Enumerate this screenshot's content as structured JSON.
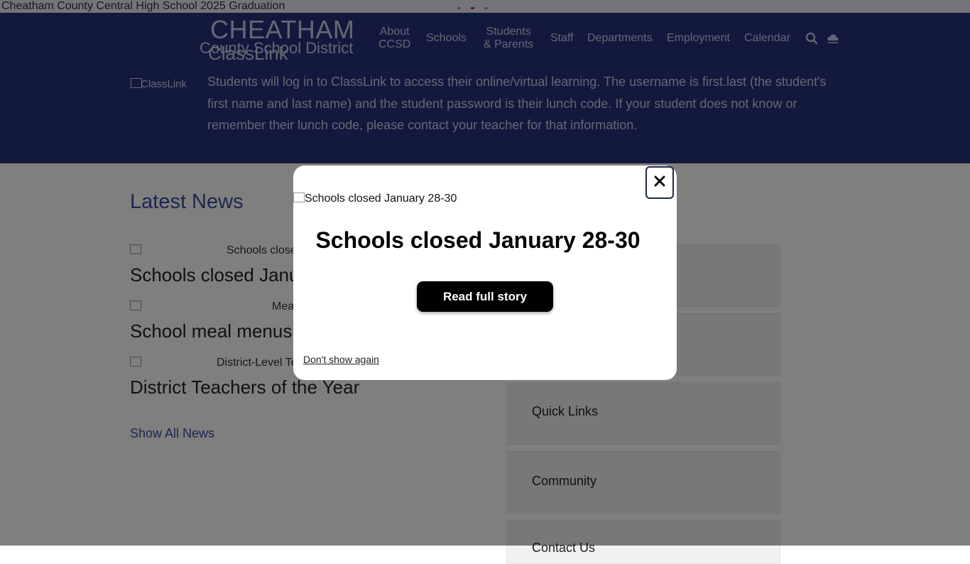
{
  "hero": {
    "image_alt": "Cheatham County Central High School 2025 Graduation",
    "dot_colors": [
      "#8a94b8",
      "#c8102e",
      "#8a94b8"
    ]
  },
  "header": {
    "logo_line1": "CHEATHAM",
    "logo_line2": "County School District",
    "logo_overlap": "ClassLink",
    "nav": [
      {
        "label_line1": "About",
        "label_line2": "CCSD"
      },
      {
        "label_line1": "Schools",
        "label_line2": ""
      },
      {
        "label_line1": "Students",
        "label_line2": "& Parents"
      },
      {
        "label_line1": "Staff",
        "label_line2": ""
      },
      {
        "label_line1": "Departments",
        "label_line2": ""
      },
      {
        "label_line1": "Employment",
        "label_line2": ""
      },
      {
        "label_line1": "Calendar",
        "label_line2": ""
      }
    ],
    "icons": {
      "search": "search-icon",
      "weather": "weather-cloud-icon"
    }
  },
  "classlink": {
    "image_alt": "ClassLink",
    "text": "Students will log in to ClassLink to access their online/virtual learning. The username is first.last (the student's first name and last name) and the student password is their lunch code. If your student does not know or remember their lunch code, please contact your teacher for that information."
  },
  "news": {
    "section_title": "Latest News",
    "items": [
      {
        "image_alt": "Schools closed",
        "title": "Schools closed January 28-30"
      },
      {
        "image_alt": "Meal",
        "title": "School meal menus"
      },
      {
        "image_alt": "District-Level Te",
        "title": "District Teachers of the Year"
      }
    ],
    "show_all": "Show All News"
  },
  "sidebar": {
    "cards": [
      "",
      "",
      "Quick Links",
      "Community",
      "Contact Us"
    ]
  },
  "modal": {
    "close_icon": "close-icon",
    "image_alt": "Schools closed January 28-30",
    "heading": "Schools closed January 28-30",
    "button_label": "Read full story",
    "dont_show": "Don't show again"
  },
  "colors": {
    "header_bg": "#26337a",
    "overlay": "rgba(0,0,0,0.5)",
    "accent_link": "#3a4ea0"
  }
}
